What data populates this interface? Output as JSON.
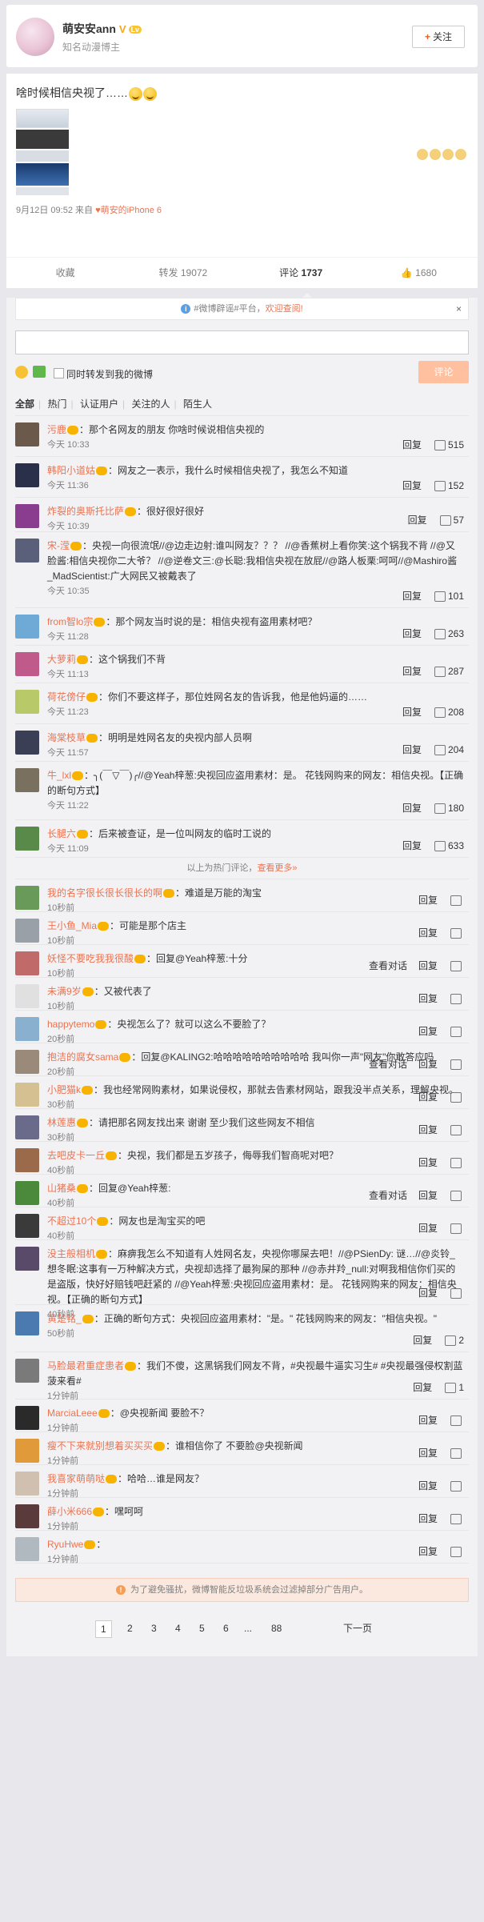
{
  "header": {
    "username": "萌安安ann",
    "tag": "知名动漫博主",
    "follow_label": "关注"
  },
  "post": {
    "text": "啥时候相信央视了……",
    "meta_time": "9月12日 09:52 来自",
    "meta_source": "萌安的iPhone 6"
  },
  "actions": {
    "fav": "收藏",
    "repost_label": "转发",
    "repost_count": "19072",
    "comment_label": "评论",
    "comment_count": "1737",
    "like_count": "1680"
  },
  "comments_panel": {
    "notice_text": "#微博辟谣#平台，",
    "notice_link": "欢迎查阅!",
    "forward_label": "同时转发到我的微博",
    "send_label": "评论",
    "filters": [
      "全部",
      "热门",
      "认证用户",
      "关注的人",
      "陌生人"
    ],
    "hot_line_text": "以上为热门评论，",
    "hot_line_link": "查看更多»",
    "warn_text": "为了避免骚扰，微博智能反垃圾系统会过滤掉部分广告用户。"
  },
  "comments": [
    {
      "name": "污鹿",
      "text": "：那个名网友的朋友 你啥时候说相信央视的",
      "time": "今天 10:33",
      "reply": "回复",
      "likes": "515",
      "avatar": "#6b5a4c"
    },
    {
      "name": "韩阳小道姑",
      "text": "：网友之一表示，我什么时候相信央视了，我怎么不知道",
      "time": "今天 11:36",
      "reply": "回复",
      "likes": "152",
      "avatar": "#2a2f4a"
    },
    {
      "name": "炸裂的奥斯托比萨",
      "text": "：很好很好很好",
      "time": "今天 10:39",
      "reply": "回复",
      "likes": "57",
      "avatar": "#8a3c8e"
    },
    {
      "name": "宋-滢",
      "text": "：央视一向很流氓//@边走边射:谁叫网友？？？ //@香蕉树上看你笑:这个锅我不背 //@又脸酱:相信央视你二大爷？ //@逆卷文三:@长聪:我相信央视在放屁//@路人板栗:呵呵//@Mashiro酱_MadScientist:广大网民又被戴表了",
      "time": "今天 10:35",
      "reply": "回复",
      "likes": "101",
      "avatar": "#5a5f7a"
    },
    {
      "name": "from智lo宗",
      "text": "：那个网友当时说的是：相信央视有盗用素材吧？",
      "time": "今天 11:28",
      "reply": "回复",
      "likes": "263",
      "avatar": "#6fa9d6"
    },
    {
      "name": "大萝莉",
      "text": "：这个锅我们不背",
      "time": "今天 11:13",
      "reply": "回复",
      "likes": "287",
      "avatar": "#c05a8a"
    },
    {
      "name": "荷花傍仔",
      "text": "：你们不要这样子，那位姓网名友的告诉我，他是他妈逼的……",
      "time": "今天 11:23",
      "reply": "回复",
      "likes": "208",
      "avatar": "#b8c96a"
    },
    {
      "name": "海棠枝草",
      "text": "：明明是姓网名友的央视内部人员啊",
      "time": "今天 11:57",
      "reply": "回复",
      "likes": "204",
      "avatar": "#3a3f55"
    },
    {
      "name": "牛_lxl",
      "text": "：╮(￣▽￣)╭//@Yeah梓葱:央视回应盗用素材：是。 花钱网购来的网友：相信央视。【正确的断句方式】",
      "time": "今天 11:22",
      "reply": "回复",
      "likes": "180",
      "avatar": "#7a7060"
    },
    {
      "name": "长腿六",
      "text": "：后来被查证，是一位叫网友的临时工说的",
      "time": "今天 11:09",
      "reply": "回复",
      "likes": "633",
      "avatar": "#5a8a4a"
    },
    {
      "name": "我的名字很长很长很长的啊",
      "text": "：难道是万能的淘宝",
      "time": "10秒前",
      "reply": "回复",
      "likes": "",
      "avatar": "#6a9a5a"
    },
    {
      "name": "王小鱼_Mia",
      "text": "：可能是那个店主",
      "time": "10秒前",
      "reply": "回复",
      "likes": "",
      "avatar": "#9aa0a8"
    },
    {
      "name": "妖怪不要吃我我很酸",
      "text": "：回复@Yeah梓葱:十分",
      "time": "10秒前",
      "reply": "回复",
      "conv": "查看对话",
      "likes": "",
      "avatar": "#c06a6a"
    },
    {
      "name": "未满9岁",
      "text": "：又被代表了",
      "time": "10秒前",
      "reply": "回复",
      "likes": "",
      "avatar": "#e0e0e0"
    },
    {
      "name": "happytemo",
      "text": "：央视怎么了？就可以这么不要脸了？",
      "time": "20秒前",
      "reply": "回复",
      "likes": "",
      "avatar": "#8ab0d0"
    },
    {
      "name": "抱洁的腐女sama",
      "text": "：回复@KALING2:哈哈哈哈哈哈哈哈哈哈 我叫你一声\"网友\"你敢答应吗",
      "time": "20秒前",
      "reply": "回复",
      "conv": "查看对话",
      "likes": "",
      "avatar": "#9a8a7a"
    },
    {
      "name": "小肥猫k",
      "text": "：我也经常网购素材，如果说侵权，那就去告素材网站，跟我没半点关系，理解央视。",
      "time": "30秒前",
      "reply": "回复",
      "likes": "",
      "avatar": "#d4c090"
    },
    {
      "name": "林莲惠",
      "text": "：请把那名网友找出来 谢谢 至少我们这些网友不相信",
      "time": "30秒前",
      "reply": "回复",
      "likes": "",
      "avatar": "#6a6a8a"
    },
    {
      "name": "去吧皮卡一丘",
      "text": "：央视，我们都是五岁孩子，侮辱我们智商呢对吧？",
      "time": "40秒前",
      "reply": "回复",
      "likes": "",
      "avatar": "#9a6a4a"
    },
    {
      "name": "山猪桑",
      "text": "：回复@Yeah梓葱:",
      "time": "40秒前",
      "reply": "回复",
      "conv": "查看对话",
      "likes": "",
      "avatar": "#4a8a3a"
    },
    {
      "name": "不超过10个",
      "text": "：网友也是淘宝买的吧",
      "time": "40秒前",
      "reply": "回复",
      "likes": "",
      "avatar": "#3a3a3a"
    },
    {
      "name": "没主般相机",
      "text": "：麻痹我怎么不知道有人姓网名友，央视你哪屎去吧！//@PSienDy: 谜…//@炎铃_想冬眠:这事有一万种解决方式，央视却选择了最狗屎的那种 //@赤井羚_null:对啊我相信你们买的是盗版，快好好赔钱吧赶紧的 //@Yeah梓葱:央视回应盗用素材：是。 花钱网购来的网友：相信央视。【正确的断句方式】",
      "time": "40秒前",
      "reply": "回复",
      "likes": "",
      "avatar": "#5a4a6a"
    },
    {
      "name": "黄楚铭_",
      "text": "：正确的断句方式：央视回应盗用素材：\"是。\" 花钱网购来的网友：\"相信央视。\"",
      "time": "50秒前",
      "reply": "回复",
      "likes": "2",
      "avatar": "#4a7ab0"
    },
    {
      "name": "马脸最君重症患者",
      "text": "：我们不傻，这黑锅我们网友不背，#央视最牛逼实习生# #央视最强侵权割蓝菠来看#",
      "time": "1分钟前",
      "reply": "回复",
      "likes": "1",
      "avatar": "#7a7a7a"
    },
    {
      "name": "MarciaLeee",
      "text": "：@央视新闻 要脸不？",
      "time": "1分钟前",
      "reply": "回复",
      "likes": "",
      "avatar": "#2a2a2a"
    },
    {
      "name": "瘦不下来就别想着买买买",
      "text": "：谁相信你了 不要脸@央视新闻",
      "time": "1分钟前",
      "reply": "回复",
      "likes": "",
      "avatar": "#e09a3a"
    },
    {
      "name": "我喜家萌萌哒",
      "text": "：哈哈…谁是网友？",
      "time": "1分钟前",
      "reply": "回复",
      "likes": "",
      "avatar": "#d0c0b0"
    },
    {
      "name": "薛小米666",
      "text": "：嘿呵呵",
      "time": "1分钟前",
      "reply": "回复",
      "likes": "",
      "avatar": "#5a3a3a"
    },
    {
      "name": "RyuHwe",
      "text": "：",
      "time": "1分钟前",
      "reply": "回复",
      "likes": "",
      "avatar": "#b0b8c0"
    }
  ],
  "pager": {
    "pages": [
      "1",
      "2",
      "3",
      "4",
      "5",
      "6",
      "...",
      "88"
    ],
    "next": "下一页"
  }
}
